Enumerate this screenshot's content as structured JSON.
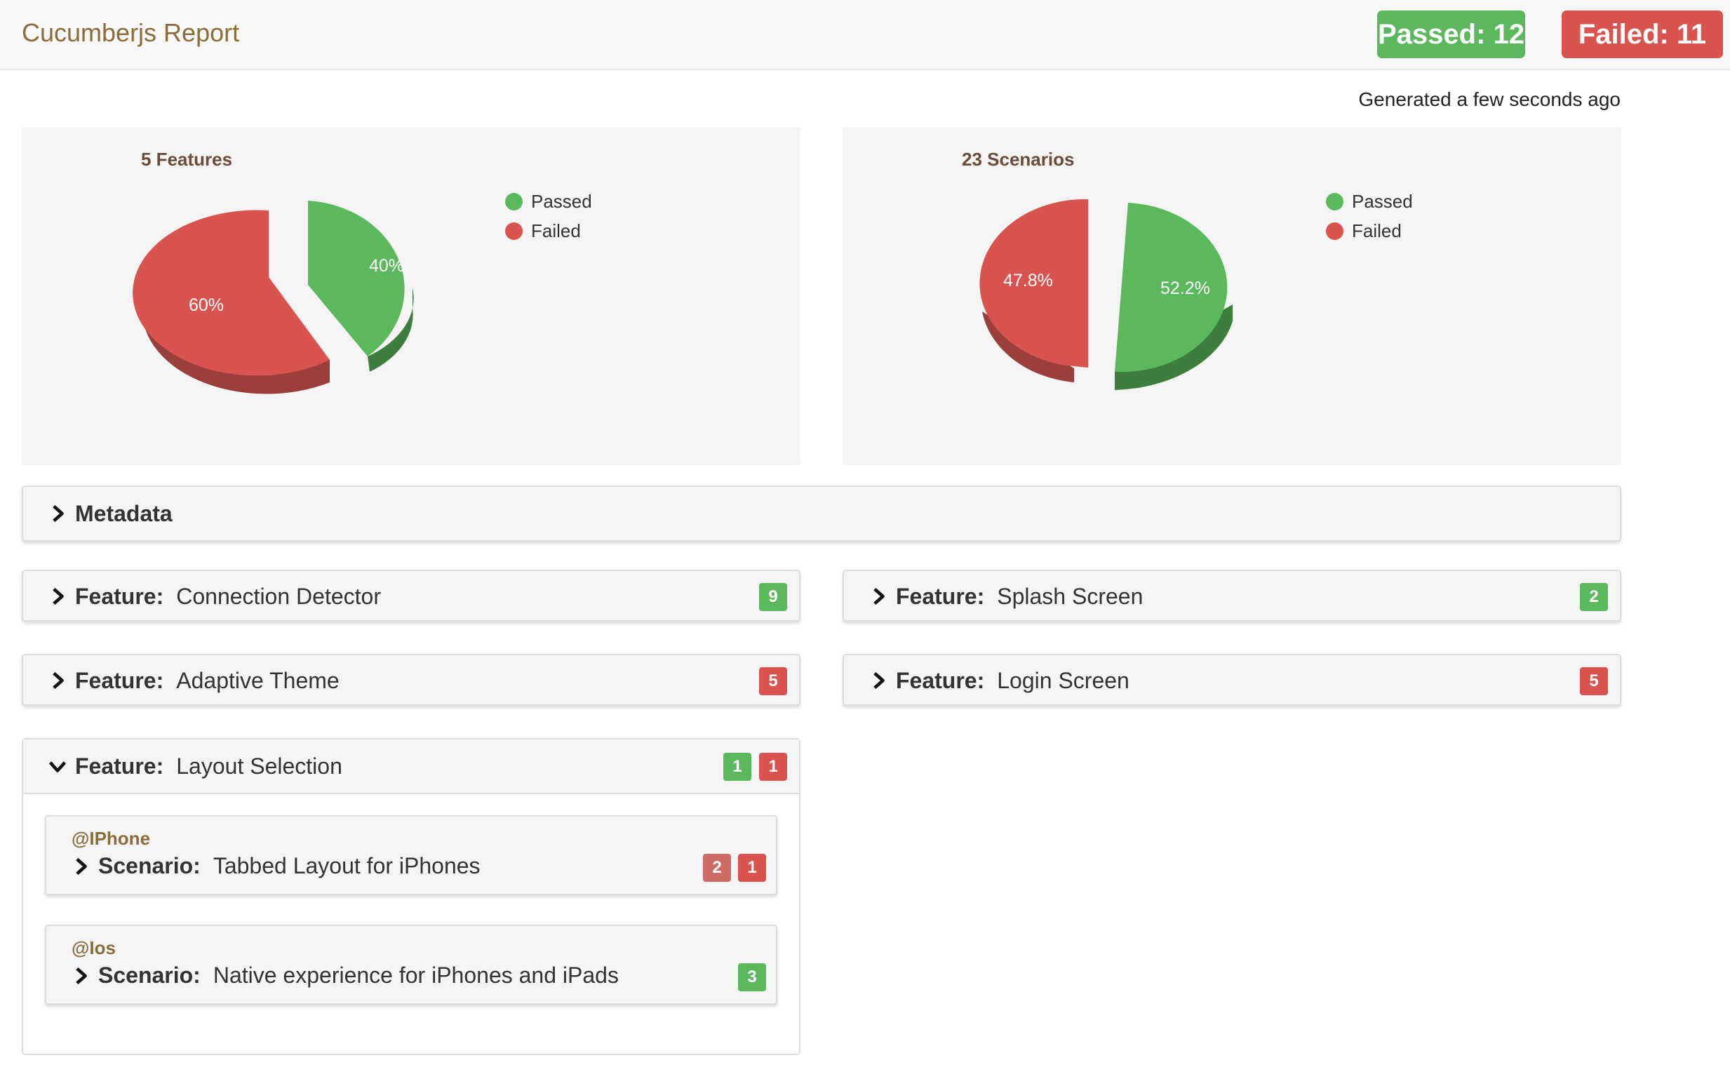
{
  "header": {
    "brand": "Cucumberjs Report",
    "passed_label": "Passed: 12",
    "failed_label": "Failed: 11"
  },
  "generated": "Generated a few seconds ago",
  "colors": {
    "passed": "#5cb85c",
    "failed": "#d9534f",
    "brand": "#8a6d3b"
  },
  "chart_data": [
    {
      "type": "pie",
      "title": "5 Features",
      "series": [
        {
          "name": "Passed",
          "value": 40,
          "label": "40%"
        },
        {
          "name": "Failed",
          "value": 60,
          "label": "60%"
        }
      ],
      "legend_position": "top-right",
      "style": "3d-exploded"
    },
    {
      "type": "pie",
      "title": "23 Scenarios",
      "series": [
        {
          "name": "Passed",
          "value": 52.2,
          "label": "52.2%"
        },
        {
          "name": "Failed",
          "value": 47.8,
          "label": "47.8%"
        }
      ],
      "legend_position": "top-right",
      "style": "3d-exploded"
    }
  ],
  "metadata": {
    "label": "Metadata",
    "icon": "chevron-right-icon"
  },
  "features": [
    {
      "keyword": "Feature:",
      "name": "Connection Detector",
      "counts": [
        {
          "value": "9",
          "status": "passed"
        }
      ]
    },
    {
      "keyword": "Feature:",
      "name": "Splash Screen",
      "counts": [
        {
          "value": "2",
          "status": "passed"
        }
      ]
    },
    {
      "keyword": "Feature:",
      "name": "Adaptive Theme",
      "counts": [
        {
          "value": "5",
          "status": "failed"
        }
      ]
    },
    {
      "keyword": "Feature:",
      "name": "Login Screen",
      "counts": [
        {
          "value": "5",
          "status": "failed"
        }
      ]
    }
  ],
  "open_feature": {
    "keyword": "Feature:",
    "name": "Layout Selection",
    "icon": "chevron-down-icon",
    "counts": [
      {
        "value": "1",
        "status": "passed"
      },
      {
        "value": "1",
        "status": "failed"
      }
    ],
    "scenarios": [
      {
        "tag": "@IPhone",
        "keyword": "Scenario:",
        "name": "Tabbed Layout for iPhones",
        "counts": [
          {
            "value": "2",
            "status": "skipped"
          },
          {
            "value": "1",
            "status": "failed"
          }
        ]
      },
      {
        "tag": "@Ios",
        "keyword": "Scenario:",
        "name": "Native experience for iPhones and iPads",
        "counts": [
          {
            "value": "3",
            "status": "passed"
          }
        ]
      }
    ]
  }
}
